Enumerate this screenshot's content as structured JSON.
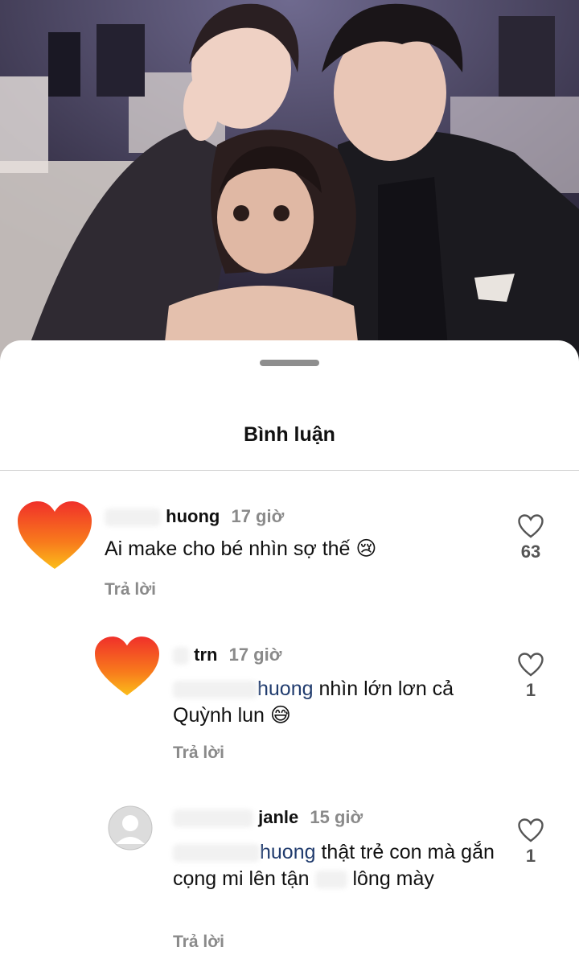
{
  "sheet": {
    "title": "Bình luận"
  },
  "comments": [
    {
      "username": "huong",
      "time": "17 giờ",
      "text": "Ai make cho bé nhìn sợ thế 😢",
      "reply_label": "Trả lời",
      "likes": "63",
      "avatar": "heart-avatar"
    },
    {
      "username": "trn",
      "time": "17 giờ",
      "mention": "huong",
      "text": " nhìn lớn lơn cả Quỳnh lun 😅",
      "reply_label": "Trả lời",
      "likes": "1",
      "avatar": "heart-avatar"
    },
    {
      "username": "janle",
      "time": "15 giờ",
      "mention": "huong",
      "text_a": " thật trẻ con mà gắn cọng mi lên tận",
      "text_b": "lông mày",
      "reply_label": "Trả lời",
      "likes": "1",
      "avatar": "default-avatar"
    }
  ],
  "colors": {
    "mention": "#213c6e",
    "secondary_text": "#8a8a8a",
    "sheet_bg": "#ffffff"
  }
}
